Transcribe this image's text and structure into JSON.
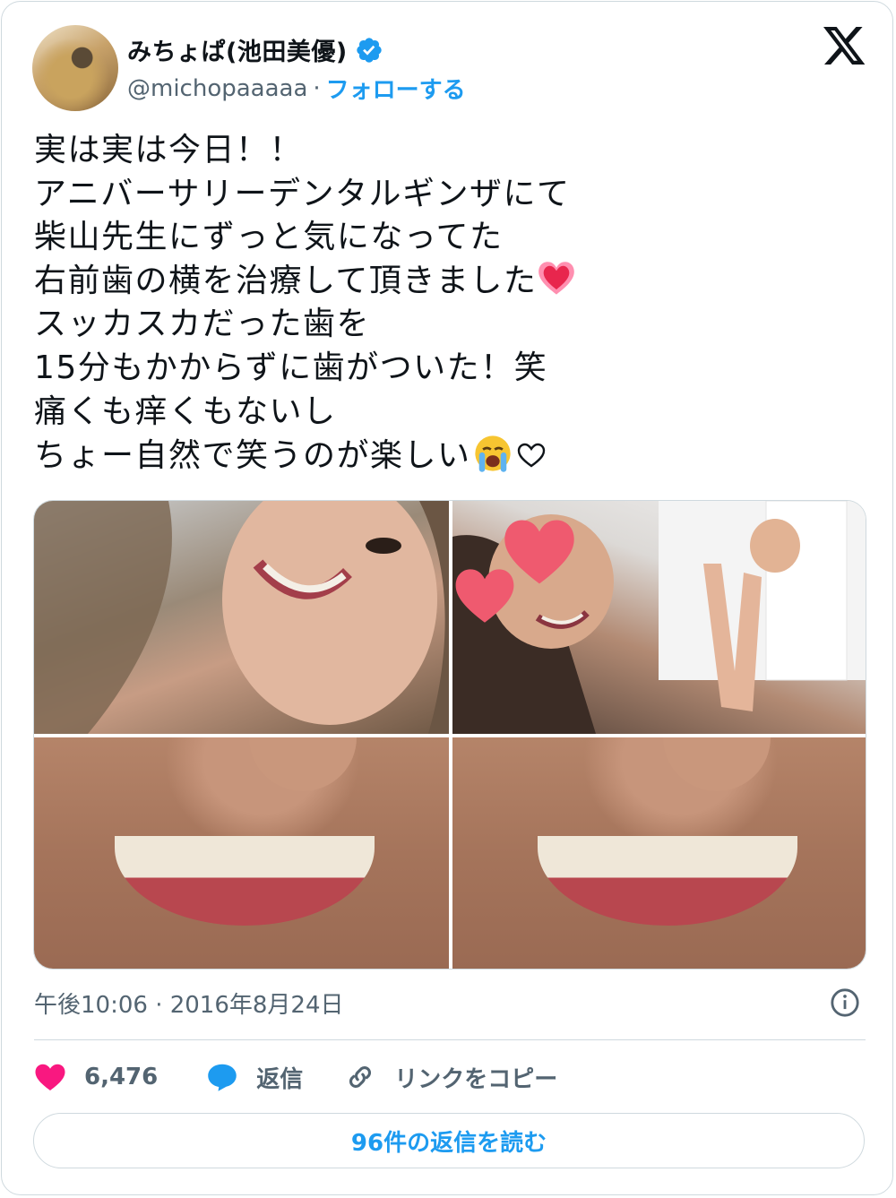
{
  "author": {
    "display_name": "みちょぱ(池田美優)",
    "handle": "@michopaaaaa",
    "separator": "·",
    "follow_label": "フォローする"
  },
  "tweet": {
    "lines": [
      "実は実は今日！！",
      "アニバーサリーデンタルギンザにて",
      "柴山先生にずっと気になってた",
      "右前歯の横を治療して頂きました",
      "スッカスカだった歯を",
      "15分もかからずに歯がついた！笑",
      "痛くも痒くもないし",
      "ちょー自然で笑うのが楽しい"
    ]
  },
  "timestamp": "午後10:06 · 2016年8月24日",
  "actions": {
    "like_count": "6,476",
    "reply_label": "返信",
    "copy_link_label": "リンクをコピー"
  },
  "read_replies_label": "96件の返信を読む",
  "colors": {
    "accent": "#1d9bf0",
    "like": "#f91880",
    "muted": "#536471",
    "border": "#cfd9de"
  },
  "icons": [
    "verified-badge-icon",
    "x-logo-icon",
    "sparkling-heart-emoji",
    "crying-face-emoji",
    "white-heart-emoji",
    "info-icon",
    "heart-icon",
    "reply-bubble-icon",
    "link-icon"
  ]
}
